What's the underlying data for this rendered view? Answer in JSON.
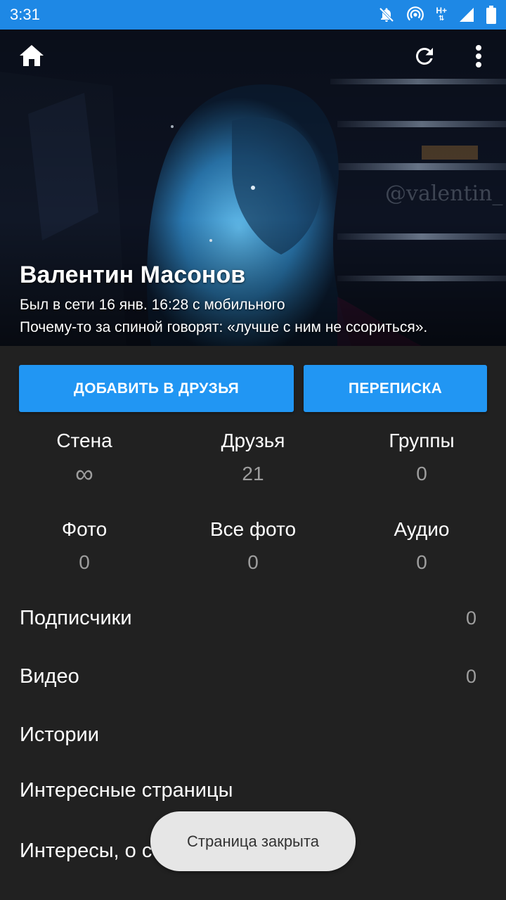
{
  "status_bar": {
    "time": "3:31",
    "network_label": "H+",
    "icons": [
      "notifications-off-icon",
      "hotspot-icon",
      "network-type-icon",
      "signal-icon",
      "battery-icon"
    ]
  },
  "toolbar": {
    "icons": [
      "home-icon",
      "refresh-icon",
      "more-vert-icon"
    ]
  },
  "profile": {
    "cover_watermark": "@valentin_",
    "name": "Валентин Масонов",
    "online": "Был в сети 16 янв. 16:28 с мобильного",
    "status": "Почему-то за спиной говорят: «лучше с ним не ссориться»."
  },
  "actions": {
    "add_friend": "ДОБАВИТЬ В ДРУЗЬЯ",
    "messages": "ПЕРЕПИСКА"
  },
  "counters": [
    {
      "label": "Стена",
      "value": "∞"
    },
    {
      "label": "Друзья",
      "value": "21"
    },
    {
      "label": "Группы",
      "value": "0"
    },
    {
      "label": "Фото",
      "value": "0"
    },
    {
      "label": "Все фото",
      "value": "0"
    },
    {
      "label": "Аудио",
      "value": "0"
    }
  ],
  "list": [
    {
      "label": "Подписчики",
      "value": "0"
    },
    {
      "label": "Видео",
      "value": "0"
    },
    {
      "label": "Истории",
      "value": ""
    },
    {
      "label": "Интересные страницы",
      "value": ""
    },
    {
      "label": "Интересы, о себе и др.",
      "value": ""
    }
  ],
  "toast": "Страница закрыта",
  "colors": {
    "status_bar": "#1e88e5",
    "accent": "#2196f3",
    "background": "#212121",
    "muted_text": "#9e9e9e",
    "toast_bg": "#e6e6e6"
  }
}
